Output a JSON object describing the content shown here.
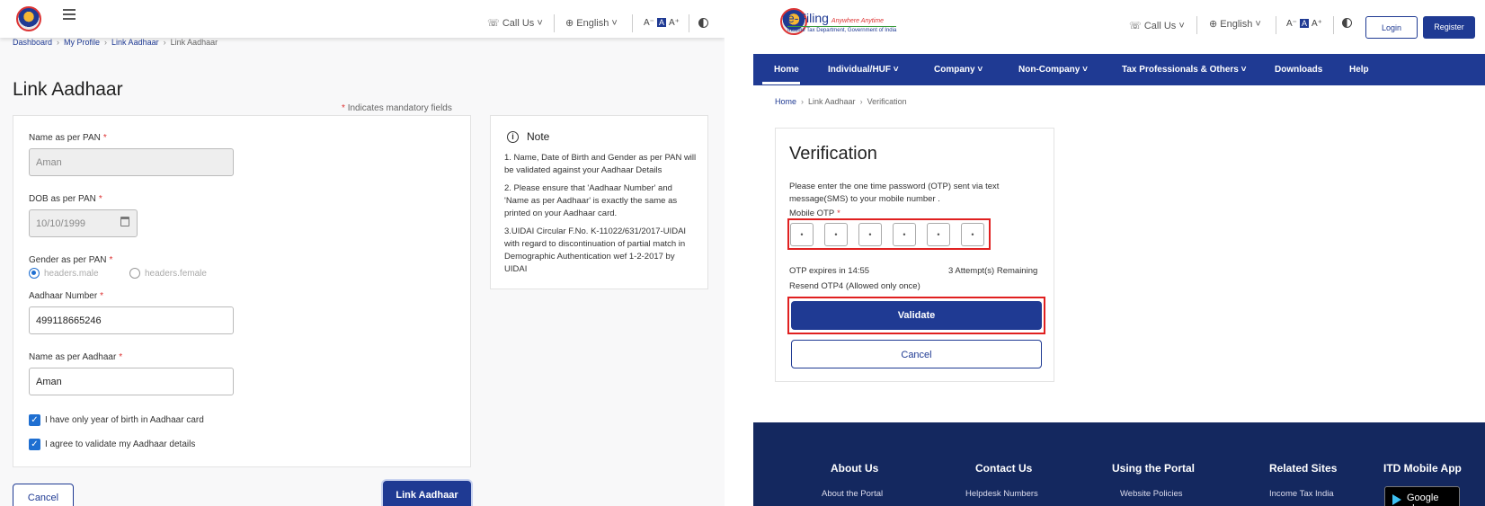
{
  "left": {
    "header": {
      "call_us": "Call Us",
      "language": "English",
      "font_small": "A⁻",
      "font_normal": "A",
      "font_large": "A⁺"
    },
    "breadcrumb": [
      "Dashboard",
      "My Profile",
      "Link Aadhaar",
      "Link Aadhaar"
    ],
    "page_title": "Link Aadhaar",
    "mandatory_note": "Indicates mandatory fields",
    "form": {
      "name_pan_label": "Name as per PAN",
      "name_pan_value": "Aman",
      "dob_label": "DOB as per PAN",
      "dob_value": "10/10/1999",
      "gender_label": "Gender as per PAN",
      "gender_male": "headers.male",
      "gender_female": "headers.female",
      "aadhaar_label": "Aadhaar Number",
      "aadhaar_value": "499118665246",
      "name_aadhaar_label": "Name as per Aadhaar",
      "name_aadhaar_value": "Aman",
      "check_year_label": "I have only year of birth in Aadhaar card",
      "check_agree_label": "I agree to validate my Aadhaar details"
    },
    "note": {
      "title": "Note",
      "p1": "1. Name, Date of Birth and Gender as per PAN will be validated against your Aadhaar Details",
      "p2": "2. Please ensure that 'Aadhaar Number' and 'Name as per Aadhaar' is exactly the same as printed on your Aadhaar card.",
      "p3": "3.UIDAI Circular F.No. K-11022/631/2017-UIDAI with regard to discontinuation of partial match in Demographic Authentication wef 1-2-2017 by UIDAI"
    },
    "buttons": {
      "cancel": "Cancel",
      "link_aadhaar": "Link Aadhaar"
    }
  },
  "right": {
    "logo": {
      "name": "e-Filing",
      "tagline": "Anywhere Anytime",
      "subtitle": "Income Tax Department, Government of India"
    },
    "header": {
      "call_us": "Call Us",
      "language": "English",
      "font_small": "A⁻",
      "font_normal": "A",
      "font_large": "A⁺",
      "login": "Login",
      "register": "Register"
    },
    "nav": [
      "Home",
      "Individual/HUF ˅",
      "Company ˅",
      "Non-Company ˅",
      "Tax Professionals & Others ˅",
      "Downloads",
      "Help"
    ],
    "breadcrumb": [
      "Home",
      "Link Aadhaar",
      "Verification"
    ],
    "verification": {
      "title": "Verification",
      "instructions": "Please enter the one time password (OTP) sent via text message(SMS) to your mobile number .",
      "otp_label": "Mobile OTP",
      "otp_digits": [
        "•",
        "•",
        "•",
        "•",
        "•",
        "•"
      ],
      "expires": "OTP expires in 14:55",
      "attempts": "3 Attempt(s) Remaining",
      "resend": "Resend OTP4  (Allowed only once)",
      "validate": "Validate",
      "cancel": "Cancel"
    },
    "footer": {
      "headings": [
        "About Us",
        "Contact Us",
        "Using the Portal",
        "Related Sites",
        "ITD Mobile App"
      ],
      "links": [
        "About the Portal",
        "Helpdesk Numbers",
        "Website Policies",
        "Income Tax India"
      ],
      "google_play": "Google play"
    }
  },
  "colors": {
    "primary": "#1f3a93",
    "footer": "#14285f",
    "highlight_frame": "#e02020",
    "required_star": "#dd3333",
    "checkbox": "#1f6fd1"
  }
}
